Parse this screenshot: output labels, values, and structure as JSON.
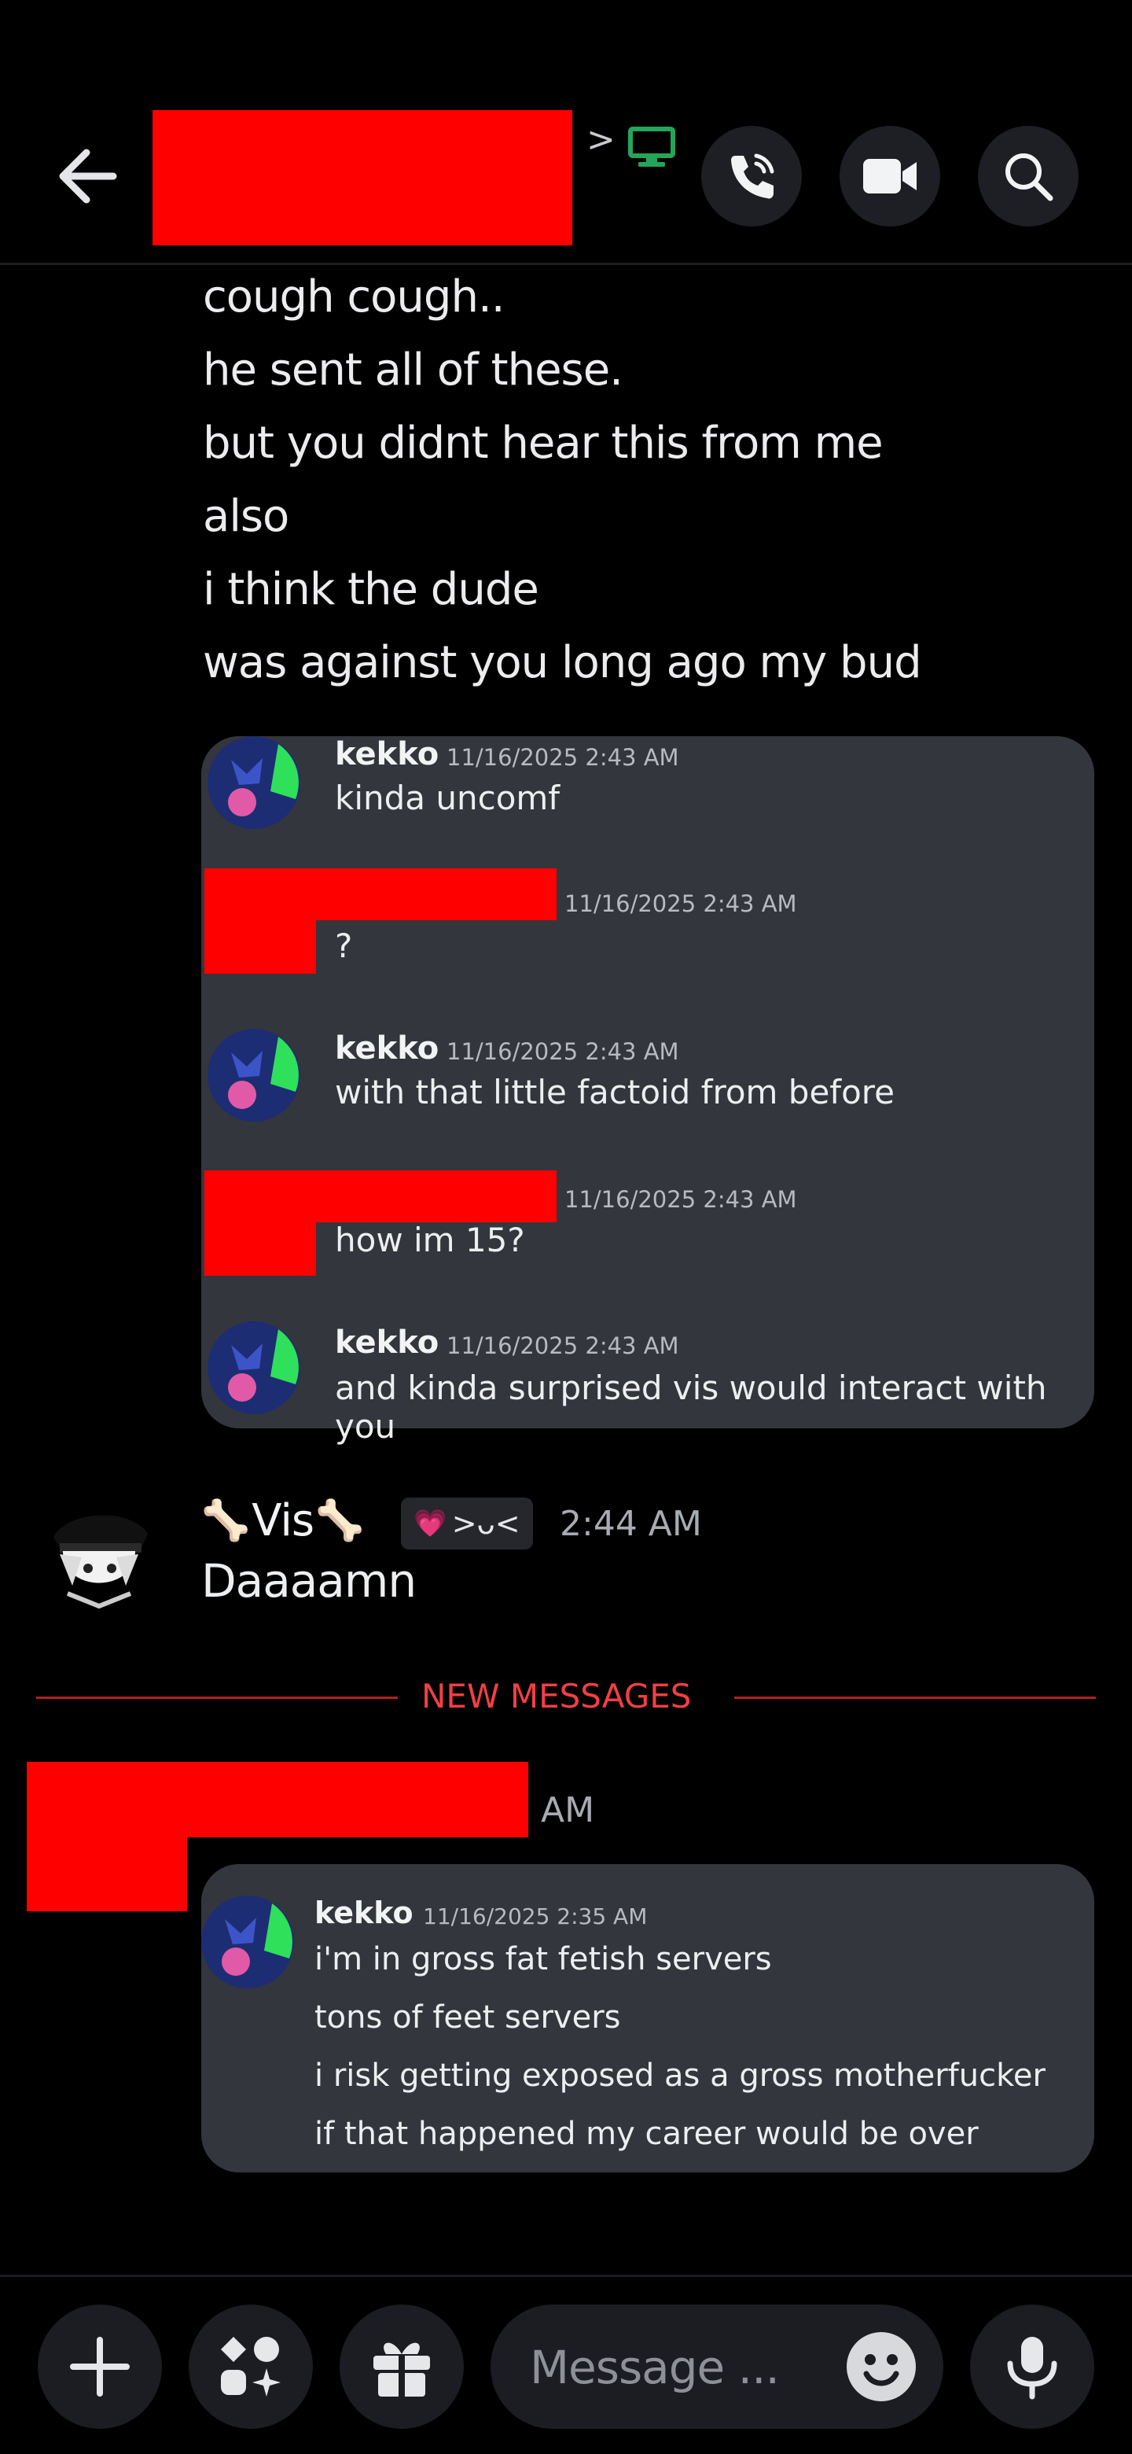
{
  "header": {
    "back_icon": "arrow-left-icon",
    "chevron": ">",
    "status_icon": "desktop-icon",
    "status_color": "#23a55a",
    "call_icon": "phone-icon",
    "video_icon": "video-camera-icon",
    "search_icon": "search-icon"
  },
  "message_lines": [
    "cough cough..",
    "he sent all of these.",
    "but you didnt hear this from me",
    "also",
    "i think the dude",
    "was against you long ago my bud"
  ],
  "quote1": [
    {
      "name": "kekko",
      "time": "11/16/2025 2:43 AM",
      "text": "kinda uncomf"
    },
    {
      "name": "",
      "time": "11/16/2025 2:43 AM",
      "text": "?"
    },
    {
      "name": "kekko",
      "time": "11/16/2025 2:43 AM",
      "text": "with that little factoid from before"
    },
    {
      "name": "",
      "time": "11/16/2025 2:43 AM",
      "text": "how im 15?"
    },
    {
      "name": "kekko",
      "time": "11/16/2025 2:43 AM",
      "text": "and kinda surprised vis would interact with you"
    }
  ],
  "vis_message": {
    "name": "Vis",
    "bone_glyph": "🦴",
    "tag_emoji": "💗",
    "tag_text": ">ᴗ<",
    "time": "2:44 AM",
    "text": "Daaaamn"
  },
  "new_messages_label": "NEW MESSAGES",
  "new_messages_color": "#f23f43",
  "redacted_time_suffix": "AM",
  "quote2": {
    "name": "kekko",
    "time": "11/16/2025 2:35 AM",
    "lines": [
      "i'm in gross fat fetish servers",
      "tons of feet servers",
      "i risk getting exposed as a gross motherfucker",
      "if that happened my career would be over"
    ]
  },
  "composer": {
    "plus_icon": "plus-icon",
    "apps_icon": "apps-icon",
    "gift_icon": "gift-icon",
    "placeholder": "Message ...",
    "emoji_icon": "emoji-icon",
    "mic_icon": "microphone-icon"
  }
}
